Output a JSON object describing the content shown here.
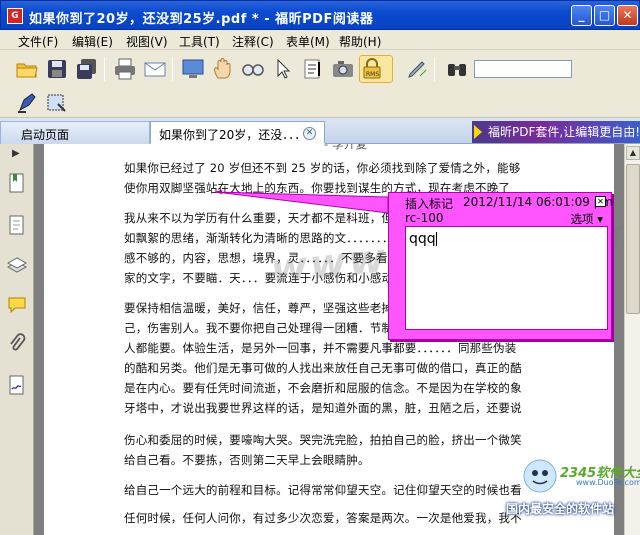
{
  "window": {
    "title": "如果你到了20岁，还没到25岁.pdf * - 福昕PDF阅读器",
    "minimize": "_",
    "maximize": "□",
    "close": "✕"
  },
  "menu": [
    "文件(F)",
    "编辑(E)",
    "视图(V)",
    "工具(T)",
    "注释(C)",
    "表单(M)",
    "帮助(H)"
  ],
  "search": {
    "value": ""
  },
  "tabs": [
    {
      "label": "启动页面"
    },
    {
      "label": "如果你到了20岁，还没．．．"
    }
  ],
  "promo": "福昕PDF套件,让编辑更自由!",
  "page_text": {
    "heading_fragment": "- 李开复",
    "p1": "如果你已经过了 20 岁但还不到 25 岁的话，你必须找到除了爱情之外，能够使你用双脚坚强站在大地上的东西。你要找到谋生的方式，现在考虑不晚了",
    "p2": "我从来不以为学历有什么重要，天才都不是科班，但．不是．．．．．．．把那些浮如飘絮的思绪，渐渐转化为清晰的思路的文．．．．．．．要知道，给予文字阅读快感不够的，内容，思想，境界，灵．．．．．．不要多看那些和你一个路数的女作家的文字，不要瞄．天．．．要流连于小感伤和小感动。",
    "p3": "要保持相信温暖，美好，信任，尊严，坚强这些老掉牙的字眼．．．．．．糟践自己，伤害别人。我不要你把自己处理得一团糟．节制．．．．．．种感情不是任何人都能要。体验生活，是另外一回事，并不需要凡事都要．．．．．．同那些伪装的酷和另类。他们是无事可做的人找出来放任自己无事可做的借口，真正的酷是在内心。要有任凭时间流逝，不会磨折和屈服的信念。不是因为在学校的象牙塔中，才说出我要世界这样的话，是知道外面的黑，脏，丑陋之后，还要说出这样的话，好好去爱，去生活。青春如此短暂，不要叹老。偶尔可以停下来休息，但是别蹲下来张望。走了一条路的时候，记得别回头看。时不时问问自己，自己在干嘛？",
    "p4": "伤心和委屈的时候，要嚎啕大哭。哭完洗完脸，拍拍自己的脸，挤出一个微笑给自己看。不要拣，否则第二天早上会眼睛肿。",
    "p5": "给自己一个远大的前程和目标。记得常常仰望天空。记住仰望天空的时候也看脚下。",
    "p6": "任何时候，任何人问你，有过多少次恋爱，答案是两次。一次是他爱我，我不爱他。一次是"
  },
  "note": {
    "label": "插入标记",
    "timestamp": "2012/11/14 06:01:09 pm",
    "author": "rc-100",
    "options": "选项 ▾",
    "close": "✕",
    "content": "qqq"
  },
  "watermark": "www.2345.com",
  "corner": {
    "brand": "2345软件大全",
    "url": "www.DuoTe.com",
    "tagline": "国内最安全的软件站"
  },
  "colors": {
    "titlebar": "#0a4bd0",
    "note_fill": "#ff55ff",
    "note_border": "#b000b0",
    "toolbar_bg": "#ece9d8"
  }
}
